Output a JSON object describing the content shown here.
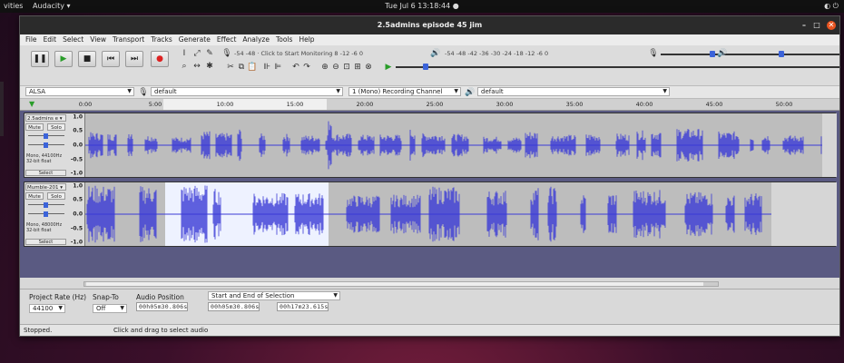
{
  "desktop": {
    "activities": "vities",
    "app_menu": "Audacity ▾",
    "clock": "Tue Jul 6  13:18:44  ●",
    "tray": "◐  ⏻"
  },
  "window": {
    "title": "2.5admins episode 45 jim",
    "buttons": {
      "minimize": "–",
      "maximize": "□",
      "close": "✕"
    }
  },
  "menubar": [
    "File",
    "Edit",
    "Select",
    "View",
    "Transport",
    "Tracks",
    "Generate",
    "Effect",
    "Analyze",
    "Tools",
    "Help"
  ],
  "transport": {
    "pause": "❚❚",
    "play": "▶",
    "stop": "■",
    "skip_start": "⏮",
    "skip_end": "⏭",
    "record": "●"
  },
  "meters": {
    "record_scale": "-54  -48  · Click to Start Monitoring  8  -12  -6  0",
    "playback_scale": "-54  -48  -42  -36  -30  -24  -18  -12  -6  0"
  },
  "device": {
    "host": "ALSA",
    "input_device": "default",
    "channels": "1 (Mono) Recording Channel",
    "output_device": "default"
  },
  "ruler": [
    "0:00",
    "5:00",
    "10:00",
    "15:00",
    "20:00",
    "25:00",
    "30:00",
    "35:00",
    "40:00",
    "45:00",
    "50:00"
  ],
  "tracks": [
    {
      "name": "2.5admins e ▾",
      "mute": "Mute",
      "solo": "Solo",
      "info1": "Mono, 44100Hz",
      "info2": "32-bit float",
      "select": "Select",
      "scale": [
        "1.0",
        "0.5",
        "0.0",
        "-0.5",
        "-1.0"
      ]
    },
    {
      "name": "Mumble-201 ▾",
      "mute": "Mute",
      "solo": "Solo",
      "info1": "Mono, 48000Hz",
      "info2": "32-bit float",
      "select": "Select",
      "scale": [
        "1.0",
        "0.5",
        "0.0",
        "-0.5",
        "-1.0"
      ]
    }
  ],
  "selection_toolbar": {
    "project_rate_label": "Project Rate (Hz)",
    "project_rate": "44100",
    "snap_label": "Snap-To",
    "snap_value": "Off",
    "audio_position_label": "Audio Position",
    "selection_mode": "Start and End of Selection",
    "audio_position": "00h05m30.806s",
    "sel_start": "00h05m30.806s",
    "sel_end": "00h17m23.615s"
  },
  "status": {
    "state": "Stopped.",
    "hint": "Click and drag to select audio"
  },
  "colors": {
    "waveform": "#3a3ad6",
    "selection": "#eef2ff",
    "track_bg": "#bdbdbd",
    "close_button": "#e95420"
  }
}
